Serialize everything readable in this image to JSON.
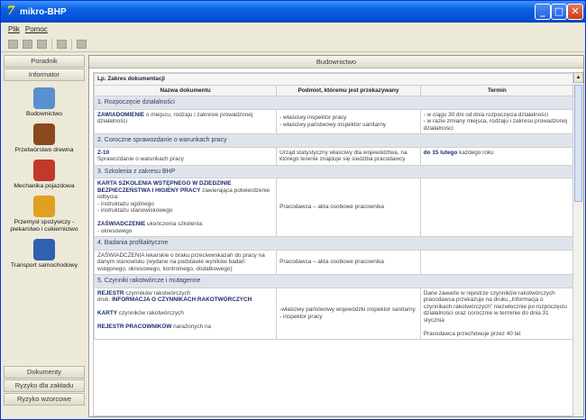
{
  "window": {
    "title": "mikro-BHP",
    "icon_glyph": "7"
  },
  "menu": {
    "file": "Plik",
    "help": "Pomoc"
  },
  "sidebar": {
    "top_tabs": [
      "Poradnik",
      "Informator"
    ],
    "items": [
      {
        "label": "Budownictwo",
        "icon": "building-icon",
        "color": "#5a8fd0"
      },
      {
        "label": "Przetwórstwo drewna",
        "icon": "wood-barrel-icon",
        "color": "#8a4a1c"
      },
      {
        "label": "Mechanika pojazdowa",
        "icon": "car-icon",
        "color": "#c0392b"
      },
      {
        "label": "Przemysł spożywczy - piekarstwo i cukiernictwo",
        "icon": "bread-icon",
        "color": "#e0a020"
      },
      {
        "label": "Transport samochodowy",
        "icon": "truck-icon",
        "color": "#3060b0"
      }
    ],
    "bottom_tabs": [
      "Dokumenty",
      "Ryzyko dla zakładu",
      "Ryzyko wzorcowe"
    ]
  },
  "main": {
    "header": "Budownictwo",
    "caption": "Lp. Zakres dokumentacji",
    "columns": [
      "Nazwa dokumentu",
      "Podmiot, któremu jest przekazywany",
      "Termin"
    ],
    "sections": [
      {
        "title": "1. Rozpoczęcie działalności",
        "rows": [
          {
            "name_b": "ZAWIADOMIENIE",
            "name": " o miejscu, rodzaju i zakresie prowadzonej działalności",
            "subject": "- właściwy inspektor pracy\n- właściwy państwowy inspektor sanitarny",
            "term": "- w ciągu 30 dni od dnia rozpoczęcia działalności\n- w razie zmiany miejsca, rodzaju i zakresu prowadzonej działalności"
          }
        ]
      },
      {
        "title": "2. Coroczne sprawozdanie o warunkach pracy",
        "rows": [
          {
            "name_b": "Z-10",
            "name": "\nSprawozdanie o warunkach pracy",
            "subject": "Urząd statystyczny właściwy dla województwa, na którego terenie znajduje się siedziba pracodawcy",
            "term_b": "do 15 lutego",
            "term": " każdego roku"
          }
        ]
      },
      {
        "title": "3. Szkolenia z zakresu BHP",
        "rows": [
          {
            "name_b": "KARTA SZKOLENIA WSTĘPNEGO W DZIEDZINIE BEZPIECZEŃSTWA I HIGIENY PRACY",
            "name": " zawierająca potwierdzenie odbycia:\n- instruktażu ogólnego\n- instruktażu stanowiskowego",
            "name2_b": "ZAŚWIADCZENIE",
            "name2": " ukończenia szkolenia:\n- okresowego",
            "subject": "Pracodawca – akta osobowe pracownika",
            "term": ""
          }
        ]
      },
      {
        "title": "4. Badania profilaktyczne",
        "rows": [
          {
            "name": "ZAŚWIADCZENIA lekarskie o braku przeciwwskazań do pracy na danym stanowisku (wydane na podstawie wyników badań: wstępnego, okresowego, kontrolnego, dodatkowego)",
            "subject": "Pracodawca – akta osobowe pracownika",
            "term": ""
          }
        ]
      },
      {
        "title": "5. Czynniki rakotwórcze i mutagenne",
        "rows": [
          {
            "name_b": "REJESTR",
            "name": " czynników rakotwórczych\ndruk: ",
            "name_b2": "INFORMACJA O CZYNNIKACH RAKOTWÓRCZYCH",
            "name2_b": "KARTY",
            "name2": " czynników rakotwórczych",
            "name3_b": "REJESTR PRACOWNIKÓW",
            "name3": " narażonych na",
            "subject": "-właściwy państwowy wojewódzki inspektor sanitarny\n- inspektor pracy",
            "term": "Dane zawarte w rejestrze czynników rakotwórczych pracodawca przekazuje na druku „Informacja o czynnikach rakotwórczych” niezwłocznie po rozpoczęciu działalności oraz corocznie w terminie do dnia 31 stycznia",
            "term2": "Pracodawca przechowuje przez 40 lat"
          }
        ]
      }
    ]
  }
}
